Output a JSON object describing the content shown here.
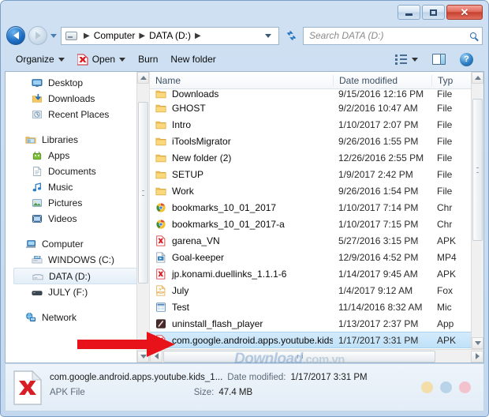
{
  "window": {
    "controls": {
      "minimize": "–",
      "maximize": "□",
      "close": "✕"
    }
  },
  "addressbar": {
    "back_icon": "back-arrow-icon",
    "forward_icon": "forward-arrow-icon",
    "history_caret": "history-dropdown-icon",
    "drive_icon": "drive-icon",
    "crumbs": [
      "Computer",
      "DATA (D:)"
    ],
    "separator": "▶",
    "refresh_icon": "↻"
  },
  "search": {
    "placeholder": "Search DATA (D:)",
    "icon": "search-icon"
  },
  "toolbar": {
    "organize": "Organize",
    "open": "Open",
    "burn": "Burn",
    "new_folder": "New folder",
    "views_icon": "views-icon",
    "preview_pane_icon": "preview-pane-icon",
    "help_icon": "?"
  },
  "sidebar": {
    "groups": [
      {
        "items": [
          {
            "label": "Desktop",
            "icon": "desktop-icon",
            "indent": true
          },
          {
            "label": "Downloads",
            "icon": "downloads-icon",
            "indent": true
          },
          {
            "label": "Recent Places",
            "icon": "recent-places-icon",
            "indent": true
          }
        ]
      },
      {
        "items": [
          {
            "label": "Libraries",
            "icon": "libraries-icon",
            "indent": false
          },
          {
            "label": "Apps",
            "icon": "apps-icon",
            "indent": true
          },
          {
            "label": "Documents",
            "icon": "documents-icon",
            "indent": true
          },
          {
            "label": "Music",
            "icon": "music-icon",
            "indent": true
          },
          {
            "label": "Pictures",
            "icon": "pictures-icon",
            "indent": true
          },
          {
            "label": "Videos",
            "icon": "videos-icon",
            "indent": true
          }
        ]
      },
      {
        "items": [
          {
            "label": "Computer",
            "icon": "computer-icon",
            "indent": false
          },
          {
            "label": "WINDOWS (C:)",
            "icon": "windows-drive-icon",
            "indent": true
          },
          {
            "label": "DATA (D:)",
            "icon": "data-drive-icon",
            "indent": true,
            "selected": true
          },
          {
            "label": "JULY (F:)",
            "icon": "usb-drive-icon",
            "indent": true
          }
        ]
      },
      {
        "items": [
          {
            "label": "Network",
            "icon": "network-icon",
            "indent": false
          }
        ]
      }
    ]
  },
  "filelist": {
    "columns": {
      "name": "Name",
      "date": "Date modified",
      "type": "Typ"
    },
    "sort_indicator": "ascending",
    "rows": [
      {
        "name": "Downloads",
        "date": "9/15/2016 12:16 PM",
        "type": "File",
        "icon": "folder-icon",
        "clipped": true
      },
      {
        "name": "GHOST",
        "date": "9/2/2016 10:47 AM",
        "type": "File",
        "icon": "folder-icon"
      },
      {
        "name": "Intro",
        "date": "1/10/2017 2:07 PM",
        "type": "File",
        "icon": "folder-icon"
      },
      {
        "name": "iToolsMigrator",
        "date": "9/26/2016 1:55 PM",
        "type": "File",
        "icon": "folder-icon"
      },
      {
        "name": "New folder (2)",
        "date": "12/26/2016 2:55 PM",
        "type": "File",
        "icon": "folder-icon"
      },
      {
        "name": "SETUP",
        "date": "1/9/2017 2:42 PM",
        "type": "File",
        "icon": "folder-icon"
      },
      {
        "name": "Work",
        "date": "9/26/2016 1:54 PM",
        "type": "File",
        "icon": "folder-icon"
      },
      {
        "name": "bookmarks_10_01_2017",
        "date": "1/10/2017 7:14 PM",
        "type": "Chr",
        "icon": "chrome-icon"
      },
      {
        "name": "bookmarks_10_01_2017-a",
        "date": "1/10/2017 7:15 PM",
        "type": "Chr",
        "icon": "chrome-icon"
      },
      {
        "name": "garena_VN",
        "date": "5/27/2016 3:15 PM",
        "type": "APK",
        "icon": "apk-icon"
      },
      {
        "name": "Goal-keeper",
        "date": "12/9/2016 4:52 PM",
        "type": "MP4",
        "icon": "video-icon"
      },
      {
        "name": "jp.konami.duellinks_1.1.1-6",
        "date": "1/14/2017 9:45 AM",
        "type": "APK",
        "icon": "apk-icon"
      },
      {
        "name": "July",
        "date": "1/4/2017 9:12 AM",
        "type": "Fox",
        "icon": "pdf-icon"
      },
      {
        "name": "Test",
        "date": "11/14/2016 8:32 AM",
        "type": "Mic",
        "icon": "excel-icon"
      },
      {
        "name": "uninstall_flash_player",
        "date": "1/13/2017 2:37 PM",
        "type": "App",
        "icon": "exe-icon"
      },
      {
        "name": "com.google.android.apps.youtube.kids_...",
        "date": "1/17/2017 3:31 PM",
        "type": "APK",
        "icon": "apk-icon",
        "selected": true
      }
    ]
  },
  "details": {
    "icon": "apk-file-icon",
    "filename": "com.google.android.apps.youtube.kids_1...",
    "filetype": "APK File",
    "date_label": "Date modified:",
    "date_value": "1/17/2017 3:31 PM",
    "size_label": "Size:",
    "size_value": "47.4 MB",
    "dot_colors": [
      "#f3dda9",
      "#b9d4e8",
      "#f2c3cc"
    ]
  },
  "annotation": {
    "arrow": "red-pointer-arrow",
    "arrow_color": "#e8131a"
  },
  "watermark": {
    "text": "Download",
    "suffix": ".com.vn"
  }
}
